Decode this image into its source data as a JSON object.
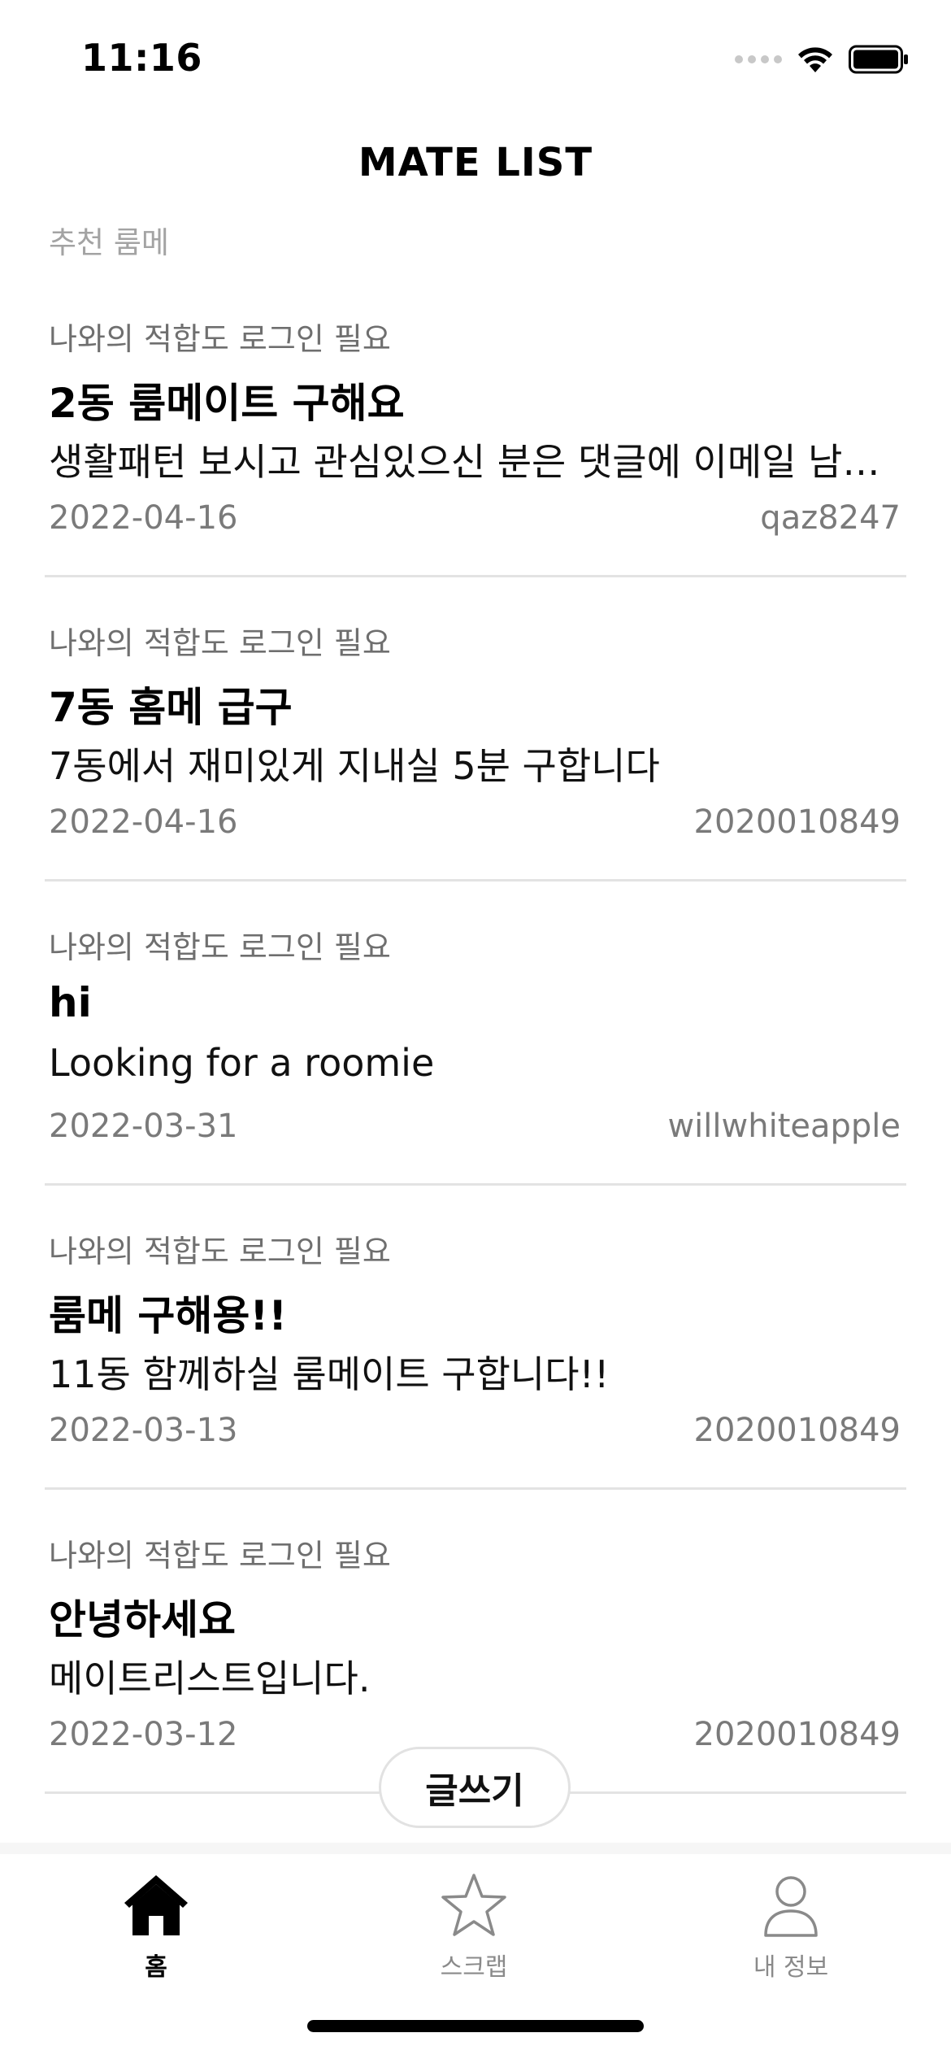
{
  "status_bar": {
    "time": "11:16"
  },
  "nav": {
    "title": "MATE LIST"
  },
  "section": {
    "label": "추천 룸메"
  },
  "posts": [
    {
      "compat": "나와의 적합도 로그인 필요",
      "title": "2동 룸메이트 구해요",
      "body": "생활패턴 보시고 관심있으신 분은 댓글에 이메일 남…",
      "date": "2022-04-16",
      "author": "qaz8247"
    },
    {
      "compat": "나와의 적합도 로그인 필요",
      "title": "7동 홈메 급구",
      "body": "7동에서 재미있게 지내실 5분 구합니다",
      "date": "2022-04-16",
      "author": "2020010849"
    },
    {
      "compat": "나와의 적합도 로그인 필요",
      "title": "hi",
      "body": "Looking for a roomie",
      "date": "2022-03-31",
      "author": "willwhiteapple"
    },
    {
      "compat": "나와의 적합도 로그인 필요",
      "title": "룸메 구해용!!",
      "body": "11동 함께하실 룸메이트 구합니다!!",
      "date": "2022-03-13",
      "author": "2020010849"
    },
    {
      "compat": "나와의 적합도 로그인 필요",
      "title": "안녕하세요",
      "body": "메이트리스트입니다.",
      "date": "2022-03-12",
      "author": "2020010849"
    }
  ],
  "write_button": {
    "label": "글쓰기"
  },
  "tab_bar": {
    "items": [
      {
        "label": "홈",
        "icon": "home-icon",
        "active": true
      },
      {
        "label": "스크랩",
        "icon": "star-icon",
        "active": false
      },
      {
        "label": "내 정보",
        "icon": "person-icon",
        "active": false
      }
    ]
  },
  "colors": {
    "active_tab": "#000000",
    "inactive_tab": "#8a8a8a",
    "divider": "#e3e3e3",
    "meta_text": "#7a7a7a"
  }
}
